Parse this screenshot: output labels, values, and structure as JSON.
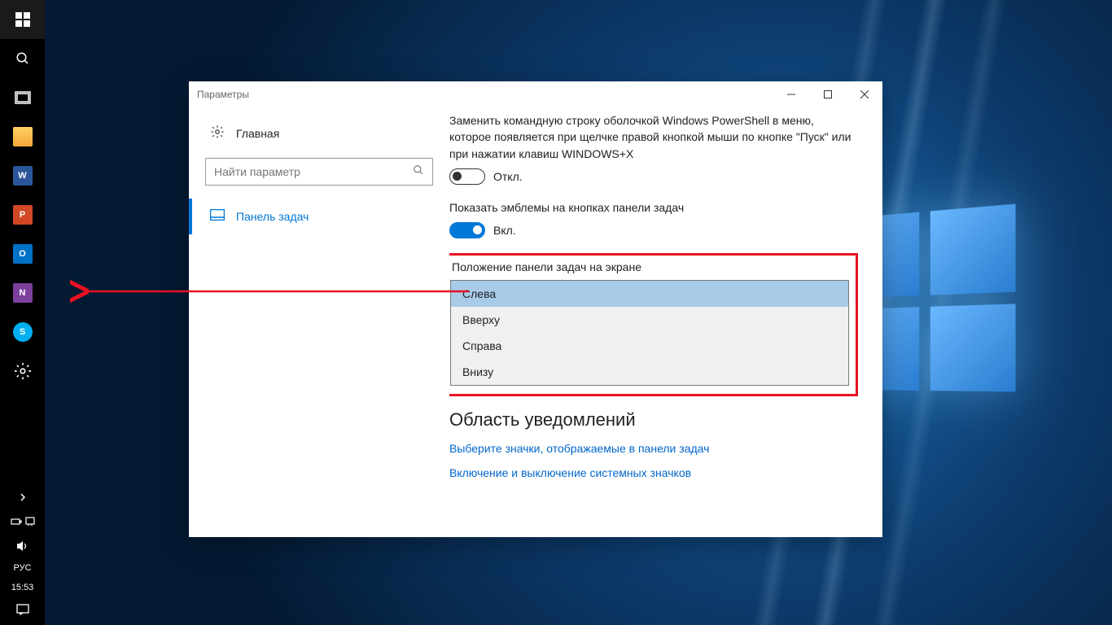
{
  "taskbar": {
    "apps": [
      "file-explorer",
      "word",
      "powerpoint",
      "outlook",
      "onenote",
      "skype"
    ],
    "lang": "РУС",
    "clock": "15:53"
  },
  "window": {
    "title": "Параметры",
    "sidebar": {
      "home": "Главная",
      "search_placeholder": "Найти параметр",
      "nav_item": "Панель задач"
    },
    "main": {
      "powershell_desc": "Заменить командную строку оболочкой Windows PowerShell в меню, которое появляется при щелчке правой кнопкой мыши по кнопке \"Пуск\" или при нажатии клавиш WINDOWS+X",
      "powershell_state": "Откл.",
      "badges_label": "Показать эмблемы на кнопках панели задач",
      "badges_state": "Вкл.",
      "position_label": "Положение панели задач на экране",
      "position_options": [
        "Слева",
        "Вверху",
        "Справа",
        "Внизу"
      ],
      "notif_heading": "Область уведомлений",
      "link_icons": "Выберите значки, отображаемые в панели задач",
      "link_system": "Включение и выключение системных значков"
    }
  }
}
